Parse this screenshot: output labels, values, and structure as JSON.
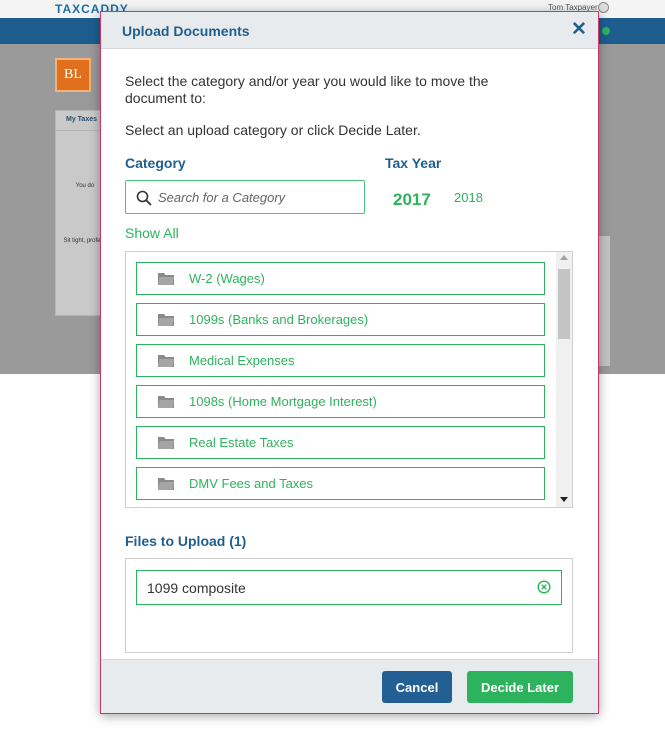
{
  "background": {
    "logo": "TAXCADDY",
    "user": "Tom Taxpayer",
    "avatar": "BL",
    "panel_header": "My Taxes",
    "panel_text": "You do",
    "panel_text2": "Sit tight, profess"
  },
  "modal": {
    "title": "Upload Documents",
    "close": "✕",
    "instruction1": "Select the category and/or year you would like to move the document to:",
    "instruction2": "Select an upload category or click Decide Later.",
    "category_label": "Category",
    "tax_year_label": "Tax Year",
    "search_placeholder": "Search for a Category",
    "years": {
      "active": "2017",
      "other": "2018"
    },
    "show_all": "Show All",
    "categories": [
      "W-2 (Wages)",
      "1099s (Banks and Brokerages)",
      "Medical Expenses",
      "1098s (Home Mortgage Interest)",
      "Real Estate Taxes",
      "DMV Fees and Taxes"
    ],
    "files_label": "Files to Upload (1)",
    "files": [
      "1099 composite"
    ],
    "cancel": "Cancel",
    "decide_later": "Decide Later"
  },
  "colors": {
    "accent_green": "#2db35d",
    "header_blue": "#1f5f8e",
    "cancel_blue": "#245f93",
    "nav_blue": "#1d5e8f"
  },
  "icons": [
    "search-icon",
    "folder-icon",
    "close-icon",
    "remove-circle-icon"
  ]
}
